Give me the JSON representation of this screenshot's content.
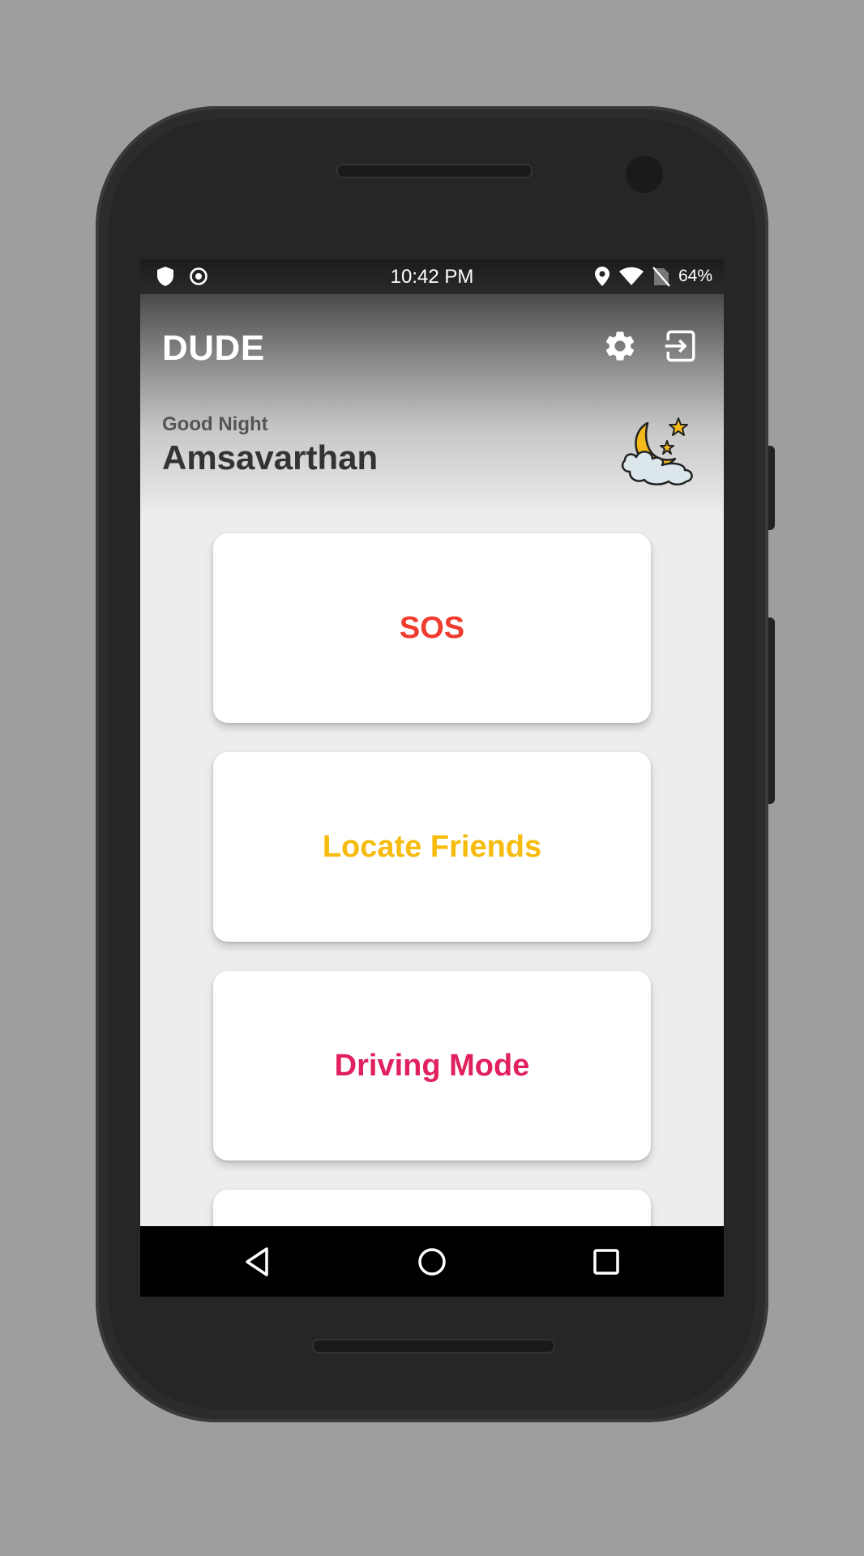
{
  "status_bar": {
    "time": "10:42 PM",
    "battery": "64%",
    "left_icons": [
      "shield-icon",
      "target-icon"
    ],
    "right_icons": [
      "location-icon",
      "wifi-icon",
      "no-sim-icon"
    ]
  },
  "header": {
    "title": "DUDE",
    "greeting": "Good Night",
    "username": "Amsavarthan",
    "actions": [
      "settings-icon",
      "logout-icon"
    ],
    "time_of_day_icon": "moon-stars-cloud-icon"
  },
  "cards": [
    {
      "label": "SOS",
      "color": "#f03c2e"
    },
    {
      "label": "Locate Friends",
      "color": "#f6bb0c"
    },
    {
      "label": "Driving Mode",
      "color": "#e0215e"
    }
  ],
  "nav_bar": [
    "back-icon",
    "home-icon",
    "recents-icon"
  ]
}
